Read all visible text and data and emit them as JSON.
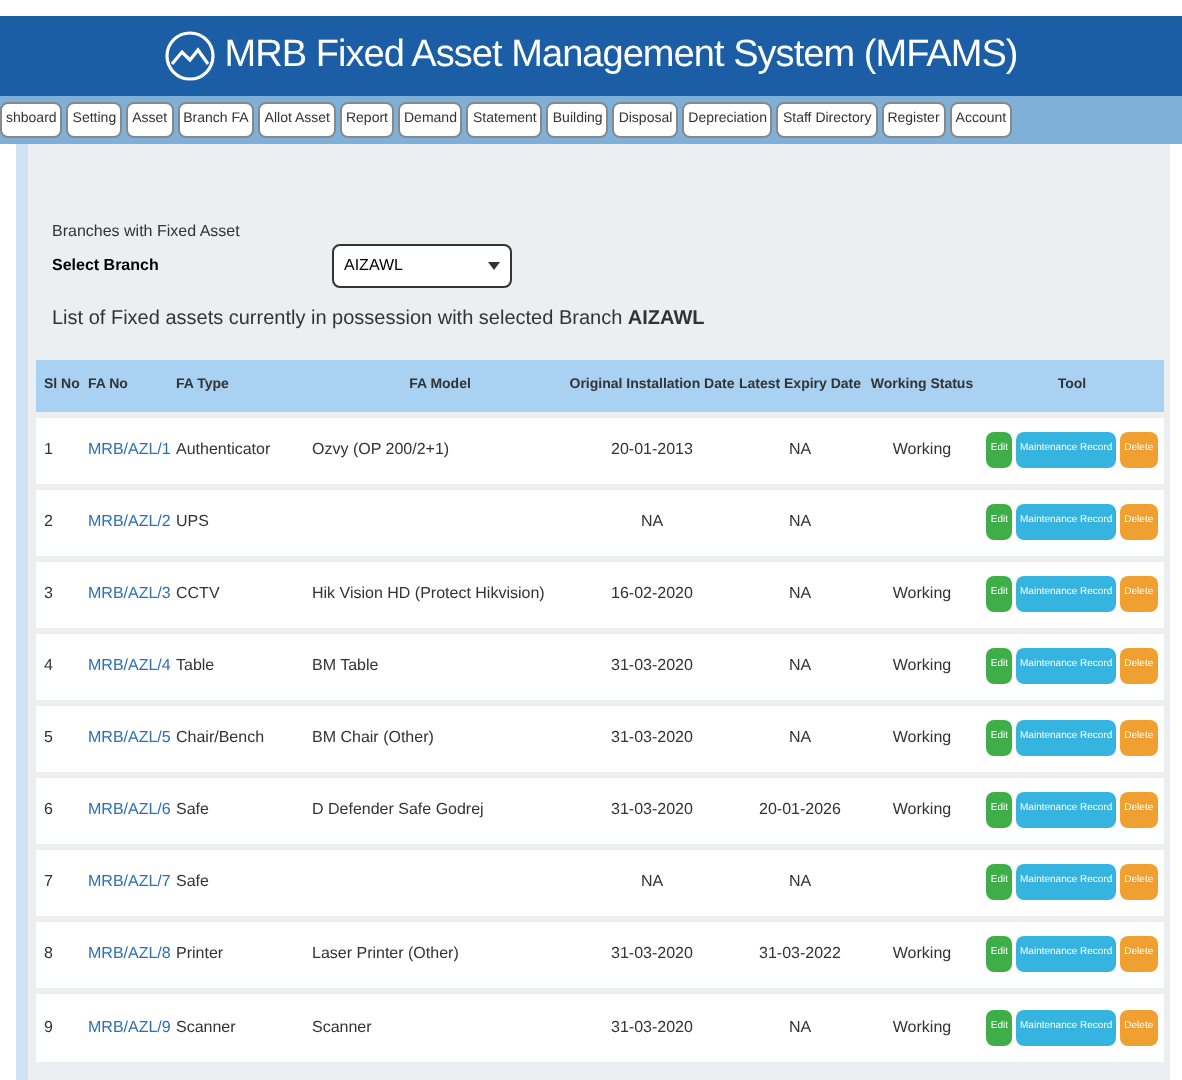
{
  "header": {
    "title": "MRB Fixed Asset Management System (MFAMS)"
  },
  "tabs": [
    {
      "label": "shboard",
      "selected": false
    },
    {
      "label": "Setting",
      "selected": false
    },
    {
      "label": "Asset",
      "selected": false
    },
    {
      "label": "Branch FA",
      "selected": false
    },
    {
      "label": "Allot Asset",
      "selected": false
    },
    {
      "label": "Report",
      "selected": false
    },
    {
      "label": "Demand",
      "selected": false
    },
    {
      "label": "Statement",
      "selected": false
    },
    {
      "label": "Building",
      "selected": false
    },
    {
      "label": "Disposal",
      "selected": false
    },
    {
      "label": "Depreciation",
      "selected": false
    },
    {
      "label": "Staff Directory",
      "selected": false
    },
    {
      "label": "Register",
      "selected": false
    },
    {
      "label": "Account",
      "selected": false
    }
  ],
  "filter": {
    "hint": "Branches with Fixed Asset",
    "label": "Select Branch",
    "value": "AIZAWL"
  },
  "caption": "List of Fixed assets currently in possession with selected Branch **AIZAWL**",
  "table": {
    "columns": [
      "Sl No",
      "FA No",
      "FA Type",
      "FA Model",
      "Original Installation Date",
      "Latest Expiry Date",
      "Working Status",
      "Tool"
    ],
    "rows": [
      {
        "sl": "1",
        "fa_no": "MRB/AZL/1",
        "type": "Authenticator",
        "model": "Ozvy (OP 200/2+1)",
        "install": "20-01-2013",
        "expiry": "NA",
        "status": "Working",
        "tools": [
          "Edit",
          "Maintenance Record",
          "Delete"
        ]
      },
      {
        "sl": "2",
        "fa_no": "MRB/AZL/2",
        "type": "UPS",
        "model": "",
        "install": "NA",
        "expiry": "NA",
        "status": "",
        "tools": [
          "Edit",
          "Maintenance Record",
          "Delete"
        ]
      },
      {
        "sl": "3",
        "fa_no": "MRB/AZL/3",
        "type": "CCTV",
        "model": "Hik Vision HD (Protect Hikvision)",
        "install": "16-02-2020",
        "expiry": "NA",
        "status": "Working",
        "tools": [
          "Edit",
          "Maintenance Record",
          "Delete"
        ]
      },
      {
        "sl": "4",
        "fa_no": "MRB/AZL/4",
        "type": "Table",
        "model": "BM Table",
        "install": "31-03-2020",
        "expiry": "NA",
        "status": "Working",
        "tools": [
          "Edit",
          "Maintenance Record",
          "Delete"
        ]
      },
      {
        "sl": "5",
        "fa_no": "MRB/AZL/5",
        "type": "Chair/Bench",
        "model": "BM Chair (Other)",
        "install": "31-03-2020",
        "expiry": "NA",
        "status": "Working",
        "tools": [
          "Edit",
          "Maintenance Record",
          "Delete"
        ]
      },
      {
        "sl": "6",
        "fa_no": "MRB/AZL/6",
        "type": "Safe",
        "model": "D Defender Safe Godrej",
        "install": "31-03-2020",
        "expiry": "20-01-2026",
        "status": "Working",
        "tools": [
          "Edit",
          "Maintenance Record",
          "Delete"
        ]
      },
      {
        "sl": "7",
        "fa_no": "MRB/AZL/7",
        "type": "Safe",
        "model": "",
        "install": "NA",
        "expiry": "NA",
        "status": "",
        "tools": [
          "Edit",
          "Maintenance Record",
          "Delete"
        ]
      },
      {
        "sl": "8",
        "fa_no": "MRB/AZL/8",
        "type": "Printer",
        "model": "Laser Printer (Other)",
        "install": "31-03-2020",
        "expiry": "31-03-2022",
        "status": "Working",
        "tools": [
          "Edit",
          "Maintenance Record",
          "Delete"
        ]
      },
      {
        "sl": "9",
        "fa_no": "MRB/AZL/9",
        "type": "Scanner",
        "model": "Scanner",
        "install": "31-03-2020",
        "expiry": "NA",
        "status": "Working",
        "tools": [
          "Edit",
          "Maintenance Record",
          "Delete"
        ]
      }
    ]
  }
}
